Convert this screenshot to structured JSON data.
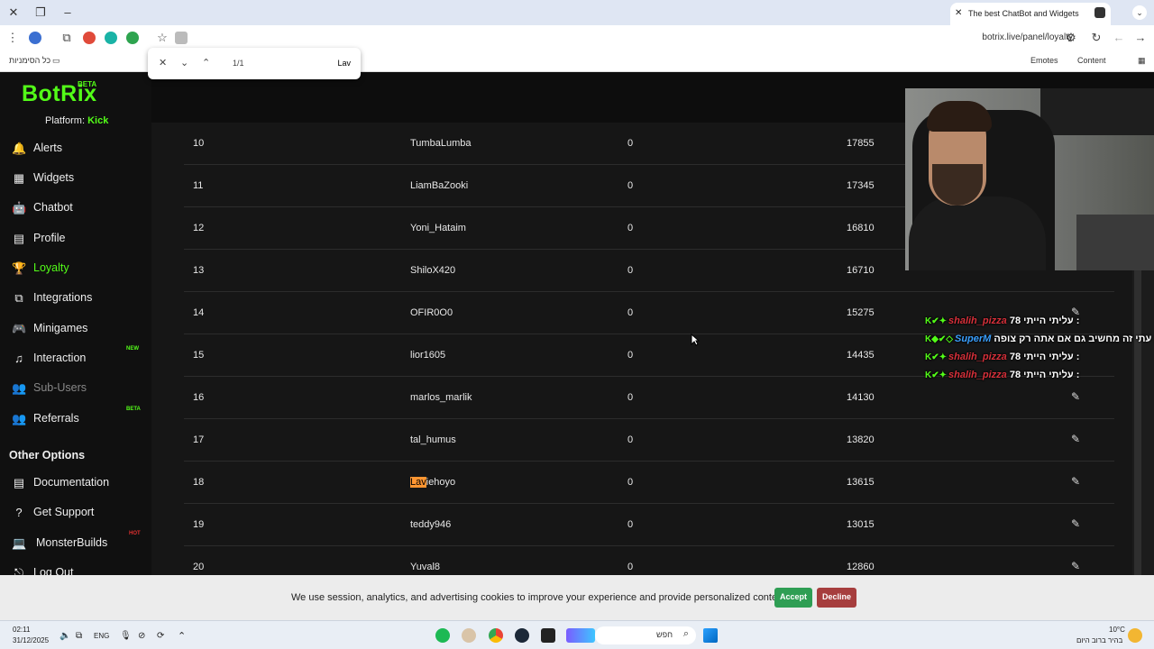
{
  "browser": {
    "tab_title": "The best ChatBot and Widgets",
    "url": "botrix.live/panel/loyalty",
    "bookmarks": {
      "all_bookmarks": "כל הסימניות",
      "emotes": "Emotes",
      "content": "Content"
    },
    "find": {
      "count": "1/1",
      "query": "Lav"
    }
  },
  "sidebar": {
    "logo": "BotRix",
    "logo_badge": "BETA",
    "platform_label": "Platform:",
    "platform_value": "Kick",
    "items": [
      {
        "label": "Alerts",
        "icon": "bell-icon",
        "glyph": "🔔"
      },
      {
        "label": "Widgets",
        "icon": "grid-icon",
        "glyph": "▦"
      },
      {
        "label": "Chatbot",
        "icon": "robot-icon",
        "glyph": "🤖"
      },
      {
        "label": "Profile",
        "icon": "id-card-icon",
        "glyph": "▤"
      },
      {
        "label": "Loyalty",
        "icon": "trophy-icon",
        "glyph": "🏆"
      },
      {
        "label": "Integrations",
        "icon": "puzzle-icon",
        "glyph": "⧉"
      },
      {
        "label": "Minigames",
        "icon": "gamepad-icon",
        "glyph": "🎮"
      },
      {
        "label": "Interaction",
        "icon": "music-icon",
        "glyph": "♫",
        "badge": "NEW"
      },
      {
        "label": "Sub-Users",
        "icon": "users-icon",
        "glyph": "👥"
      },
      {
        "label": "Referrals",
        "icon": "users-icon",
        "glyph": "👥",
        "badge": "BETA"
      }
    ],
    "other_title": "Other Options",
    "other_items": [
      {
        "label": "Documentation",
        "icon": "book-icon",
        "glyph": "▤"
      },
      {
        "label": "Get Support",
        "icon": "question-icon",
        "glyph": "?"
      },
      {
        "label": "MonsterBuilds",
        "icon": "laptop-icon",
        "glyph": "💻",
        "badge": "HOT"
      },
      {
        "label": "Log Out",
        "icon": "logout-icon",
        "glyph": "⎋"
      }
    ]
  },
  "leaderboard": {
    "rows": [
      {
        "rank": "10",
        "user": "TumbaLumba",
        "value": "0",
        "points": "17855"
      },
      {
        "rank": "11",
        "user": "LiamBaZooki",
        "value": "0",
        "points": "17345"
      },
      {
        "rank": "12",
        "user": "Yoni_Hataim",
        "value": "0",
        "points": "16810"
      },
      {
        "rank": "13",
        "user": "ShiloX420",
        "value": "0",
        "points": "16710"
      },
      {
        "rank": "14",
        "user": "OFIR0O0",
        "value": "0",
        "points": "15275"
      },
      {
        "rank": "15",
        "user": "lior1605",
        "value": "0",
        "points": "14435"
      },
      {
        "rank": "16",
        "user": "marlos_marlik",
        "value": "0",
        "points": "14130"
      },
      {
        "rank": "17",
        "user": "tal_humus",
        "value": "0",
        "points": "13820"
      },
      {
        "rank": "18",
        "user_highlight": "Lav",
        "user_rest": "iehoyo",
        "value": "0",
        "points": "13615"
      },
      {
        "rank": "19",
        "user": "teddy946",
        "value": "0",
        "points": "13015"
      },
      {
        "rank": "20",
        "user": "Yuval8",
        "value": "0",
        "points": "12860"
      }
    ]
  },
  "cookie": {
    "message": "We use session, analytics, and advertising cookies to improve your experience and provide personalized content.",
    "accept": "Accept",
    "decline": "Decline"
  },
  "chat": [
    {
      "user": "shalih_pizza",
      "message": "עליתי הייתי 78 :",
      "color": "red"
    },
    {
      "user": "SuperM",
      "message": "עתי זה מחשיב גם אם אתה רק צופה :",
      "color": "blue"
    },
    {
      "user": "shalih_pizza",
      "message": "עליתי הייתי 78 :",
      "color": "red"
    },
    {
      "user": "shalih_pizza",
      "message": "עליתי הייתי 78 :",
      "color": "red"
    }
  ],
  "taskbar": {
    "time": "02:11",
    "date": "31/12/2025",
    "lang": "ENG",
    "search": "חפש",
    "weather_temp": "10°C",
    "weather_desc": "בהיר ברוב היום"
  }
}
